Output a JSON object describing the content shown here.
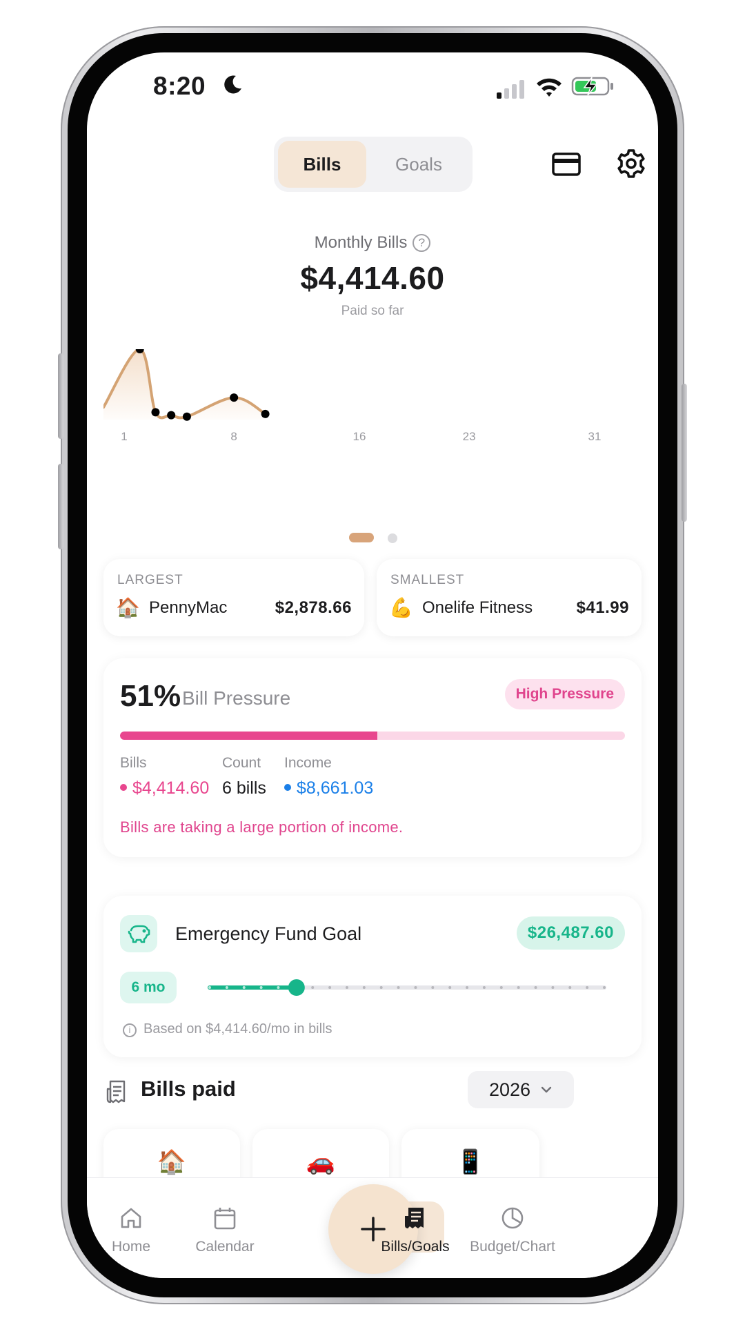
{
  "status_bar": {
    "time": "8:20"
  },
  "segment": {
    "bills": "Bills",
    "goals": "Goals",
    "selected": "Bills"
  },
  "monthly": {
    "label": "Monthly Bills",
    "help": "?",
    "amount": "$4,414.60",
    "subtitle": "Paid so far"
  },
  "chart_data": {
    "type": "area",
    "x_ticks": [
      "1",
      "8",
      "16",
      "23",
      "31"
    ],
    "xlim": [
      0,
      31
    ],
    "points": [
      {
        "x": 2,
        "y": 2878.66
      },
      {
        "x": 3,
        "y": 300
      },
      {
        "x": 4,
        "y": 180
      },
      {
        "x": 5,
        "y": 120
      },
      {
        "x": 8,
        "y": 900
      },
      {
        "x": 10,
        "y": 230
      }
    ],
    "line_color": "#d4a373",
    "marker_color": "#000000"
  },
  "extremes": {
    "largest": {
      "label": "LARGEST",
      "emoji": "🏠",
      "name": "PennyMac",
      "amount": "$2,878.66"
    },
    "smallest": {
      "label": "SMALLEST",
      "emoji": "💪",
      "name": "Onelife Fitness",
      "amount": "$41.99"
    }
  },
  "pressure": {
    "percent": "51%",
    "title": "Bill Pressure",
    "badge": "High Pressure",
    "fill_fraction": 0.51,
    "bills_label": "Bills",
    "bills_value": "$4,414.60",
    "count_label": "Count",
    "count_value": "6 bills",
    "income_label": "Income",
    "income_value": "$8,661.03",
    "note": "Bills are taking a large portion of income.",
    "colors": {
      "bills": "#e8468e",
      "income": "#1a7fe8"
    }
  },
  "emergency": {
    "title": "Emergency Fund Goal",
    "amount": "$26,487.60",
    "months": "6 mo",
    "slider_fraction": 0.22,
    "note": "Based on $4,414.60/mo in bills",
    "accent": "#17b58a"
  },
  "bills_paid": {
    "title": "Bills paid",
    "year": "2026",
    "cards": [
      {
        "emoji": "🏠"
      },
      {
        "emoji": "🚗"
      },
      {
        "emoji": "📱"
      }
    ]
  },
  "tabs": [
    {
      "label": "Home",
      "icon": "home-icon"
    },
    {
      "label": "Calendar",
      "icon": "calendar-icon"
    },
    {
      "label": "Bills/Goals",
      "icon": "receipt-icon",
      "active": true
    },
    {
      "label": "Budget/Chart",
      "icon": "pie-icon"
    }
  ],
  "fab": {
    "icon": "plus-icon"
  }
}
